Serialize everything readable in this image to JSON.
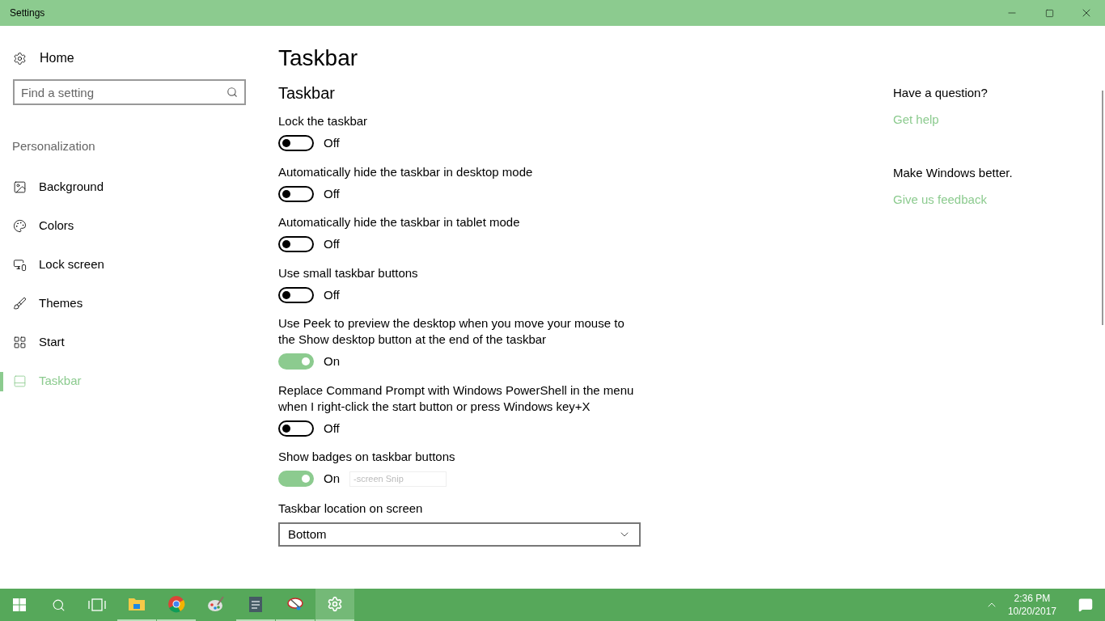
{
  "window": {
    "title": "Settings"
  },
  "sidebar": {
    "home": "Home",
    "search": {
      "placeholder": "Find a setting"
    },
    "section": "Personalization",
    "items": [
      {
        "label": "Background",
        "selected": false
      },
      {
        "label": "Colors",
        "selected": false
      },
      {
        "label": "Lock screen",
        "selected": false
      },
      {
        "label": "Themes",
        "selected": false
      },
      {
        "label": "Start",
        "selected": false
      },
      {
        "label": "Taskbar",
        "selected": true
      }
    ]
  },
  "page": {
    "title": "Taskbar",
    "section": "Taskbar",
    "settings": [
      {
        "kind": "toggle",
        "label": "Lock the taskbar",
        "on": false,
        "state": "Off"
      },
      {
        "kind": "toggle",
        "label": "Automatically hide the taskbar in desktop mode",
        "on": false,
        "state": "Off"
      },
      {
        "kind": "toggle",
        "label": "Automatically hide the taskbar in tablet mode",
        "on": false,
        "state": "Off"
      },
      {
        "kind": "toggle",
        "label": "Use small taskbar buttons",
        "on": false,
        "state": "Off"
      },
      {
        "kind": "toggle",
        "label": "Use Peek to preview the desktop when you move your mouse to the Show desktop button at the end of the taskbar",
        "on": true,
        "state": "On"
      },
      {
        "kind": "toggle",
        "label": "Replace Command Prompt with Windows PowerShell in the menu when I right-click the start button or press Windows key+X",
        "on": false,
        "state": "Off"
      },
      {
        "kind": "toggle",
        "label": "Show badges on taskbar buttons",
        "on": true,
        "state": "On",
        "tooltip": "-screen Snip"
      },
      {
        "kind": "dropdown",
        "label": "Taskbar location on screen",
        "value": "Bottom"
      }
    ]
  },
  "help": [
    {
      "heading": "Have a question?",
      "link": "Get help"
    },
    {
      "heading": "Make Windows better.",
      "link": "Give us feedback"
    }
  ],
  "taskbar": {
    "apps": [
      {
        "running": true,
        "selected": false
      },
      {
        "running": true,
        "selected": false
      },
      {
        "running": false,
        "selected": false
      },
      {
        "running": true,
        "selected": false
      },
      {
        "running": true,
        "selected": false
      },
      {
        "running": true,
        "selected": true
      }
    ],
    "time": "2:36 PM",
    "date": "10/20/2017"
  }
}
